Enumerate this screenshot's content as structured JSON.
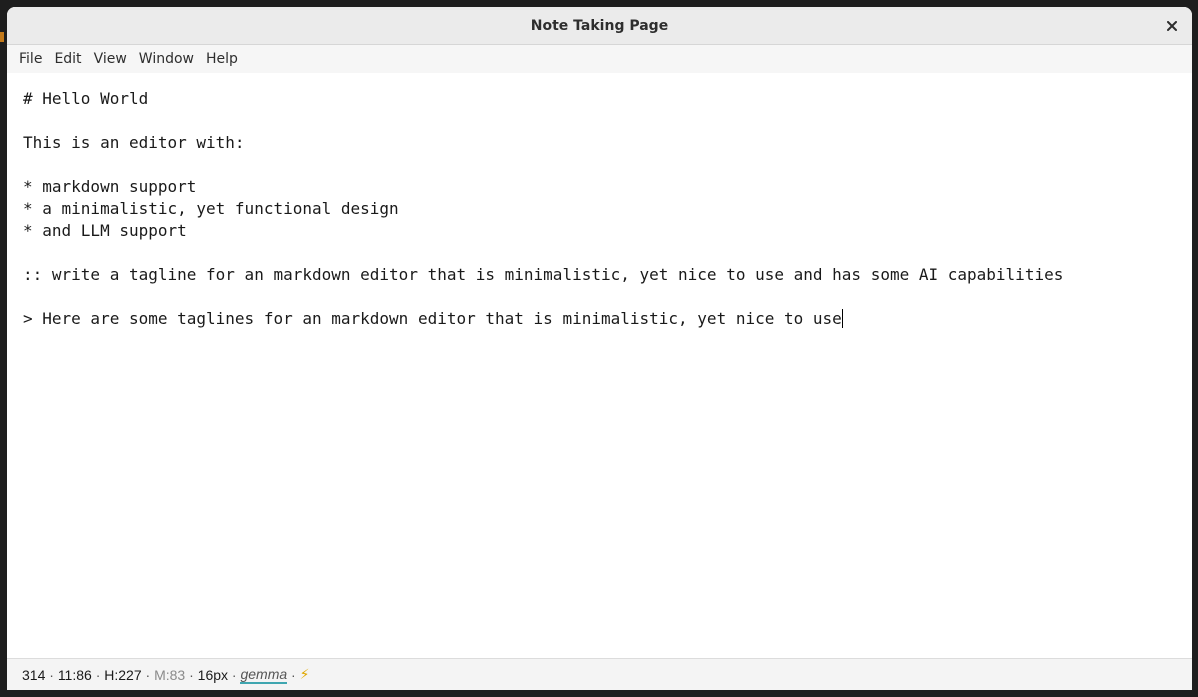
{
  "window": {
    "title": "Note Taking Page"
  },
  "menu": {
    "items": [
      "File",
      "Edit",
      "View",
      "Window",
      "Help"
    ]
  },
  "editor": {
    "lines": [
      "# Hello World",
      "",
      "This is an editor with:",
      "",
      "* markdown support",
      "* a minimalistic, yet functional design",
      "* and LLM support",
      "",
      ":: write a tagline for an markdown editor that is minimalistic, yet nice to use and has some AI capabilities",
      "",
      "> Here are some taglines for an markdown editor that is minimalistic, yet nice to use"
    ]
  },
  "status": {
    "words": "314",
    "position": "11:86",
    "headings": "H:227",
    "margin": "M:83",
    "font_size": "16px",
    "model": "gemma",
    "sep": " · ",
    "bolt": "⚡"
  },
  "colors": {
    "accent_underline": "#3fa6b0",
    "bolt": "#e0a800"
  }
}
